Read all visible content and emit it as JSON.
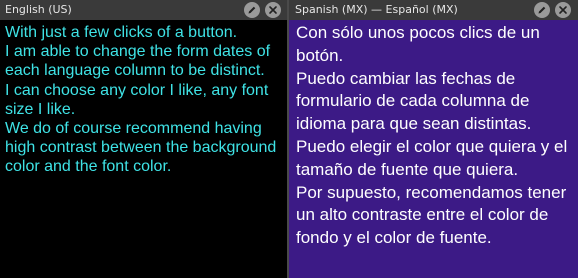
{
  "left": {
    "title": "English (US)",
    "paragraphs": [
      "With just a few clicks of a button.",
      "I am able to change the form dates of each language column to be distinct.",
      "I can choose any color I like, any font size I like.",
      "We do of course recommend having high contrast between the background color and the font color."
    ],
    "colors": {
      "background": "#000000",
      "text": "#3fe3e6"
    }
  },
  "right": {
    "title": "Spanish (MX) — Español (MX)",
    "paragraphs": [
      "Con sólo unos pocos clics de un botón.",
      "Puedo cambiar las fechas de formulario de cada columna de idioma para que sean distintas.",
      "Puedo elegir el color que quiera y el tamaño de fuente que quiera.",
      "Por supuesto, recomendamos tener un alto contraste entre el color de fondo y el color de fuente."
    ],
    "colors": {
      "background": "#3c1a86",
      "text": "#ffffff"
    }
  },
  "icons": {
    "edit": "pencil-icon",
    "close": "close-icon"
  }
}
